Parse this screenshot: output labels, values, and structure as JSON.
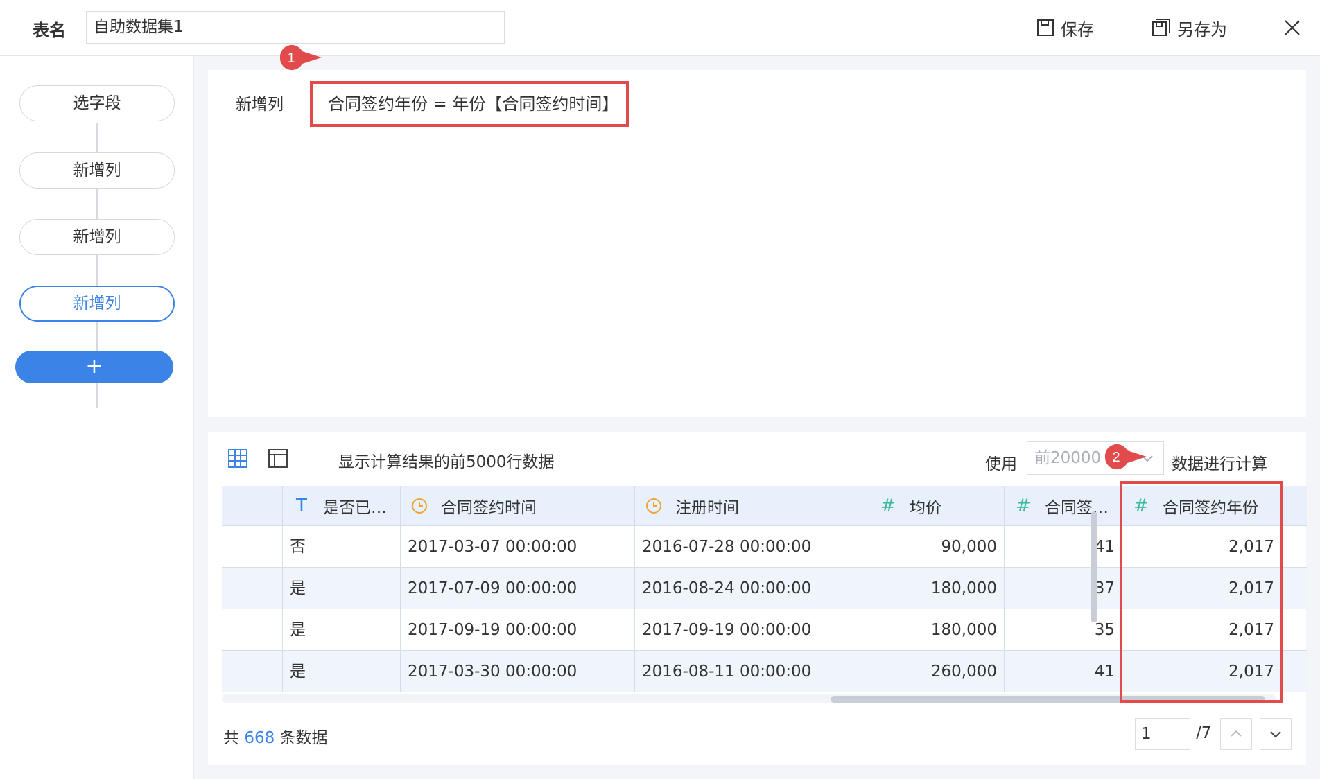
{
  "header": {
    "table_name_label": "表名",
    "table_name_value": "自助数据集1",
    "save_label": "保存",
    "save_as_label": "另存为"
  },
  "sidebar": {
    "steps": [
      {
        "label": "选字段"
      },
      {
        "label": "新增列"
      },
      {
        "label": "新增列"
      },
      {
        "label": "新增列",
        "active": true
      }
    ],
    "add_label": "+"
  },
  "editor": {
    "label": "新增列",
    "formula": "合同签约年份 = 年份【合同签约时间】"
  },
  "callouts": [
    "1",
    "2"
  ],
  "preview": {
    "title": "显示计算结果的前5000行数据",
    "use_label": "使用",
    "use_select_value": "前20000",
    "calc_label": "数据进行计算",
    "columns": [
      {
        "type": "T",
        "name": "是否已…"
      },
      {
        "type": "clock",
        "name": "合同签约时间"
      },
      {
        "type": "clock",
        "name": "注册时间"
      },
      {
        "type": "#",
        "name": "均价"
      },
      {
        "type": "#",
        "name": "合同签…"
      },
      {
        "type": "#",
        "name": "合同签约年份"
      }
    ],
    "rows": [
      [
        "否",
        "2017-03-07 00:00:00",
        "2016-07-28 00:00:00",
        "90,000",
        "41",
        "2,017"
      ],
      [
        "是",
        "2017-07-09 00:00:00",
        "2016-08-24 00:00:00",
        "180,000",
        "37",
        "2,017"
      ],
      [
        "是",
        "2017-09-19 00:00:00",
        "2017-09-19 00:00:00",
        "180,000",
        "35",
        "2,017"
      ],
      [
        "是",
        "2017-03-30 00:00:00",
        "2016-08-11 00:00:00",
        "260,000",
        "41",
        "2,017"
      ]
    ],
    "footer": {
      "prefix": "共",
      "count": "668",
      "suffix": "条数据",
      "page": "1",
      "total_pages": "/7"
    }
  },
  "colors": {
    "accent": "#3b83e7",
    "highlight": "#e24b4b",
    "number_icon": "#3bb8a0",
    "date_icon": "#f0a23b"
  }
}
